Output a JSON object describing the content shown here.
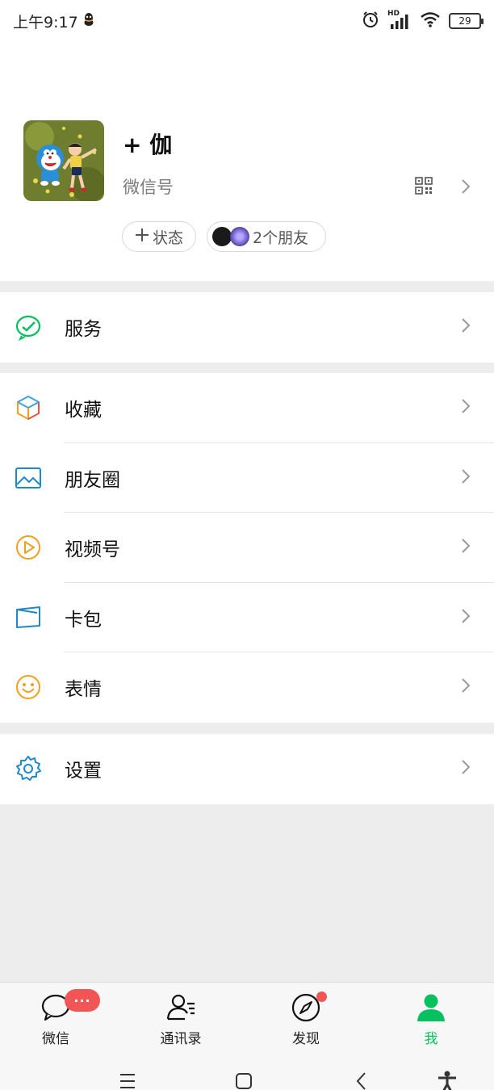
{
  "status_bar": {
    "time": "上午9:17",
    "network_label": "HD",
    "battery": "29"
  },
  "profile": {
    "nickname": "+ 伽",
    "wechat_id_label": "微信号",
    "status_button_label": "状态",
    "friends_label": "2个朋友"
  },
  "menu": {
    "service": {
      "label": "服务",
      "icon": "wechat-pay-icon",
      "color": "#07c160"
    },
    "items": [
      {
        "label": "收藏",
        "icon": "favorites-cube-icon"
      },
      {
        "label": "朋友圈",
        "icon": "moments-picture-icon",
        "color": "#1e88c8"
      },
      {
        "label": "视频号",
        "icon": "channels-play-icon",
        "color": "#f0a020"
      },
      {
        "label": "卡包",
        "icon": "card-wallet-icon",
        "color": "#1e88c8"
      },
      {
        "label": "表情",
        "icon": "sticker-smile-icon",
        "color": "#f0a020"
      }
    ],
    "settings": {
      "label": "设置",
      "icon": "gear-icon",
      "color": "#1e88c8"
    }
  },
  "tabbar": {
    "tabs": [
      {
        "label": "微信",
        "icon": "chat-bubble-icon",
        "badge": "···"
      },
      {
        "label": "通讯录",
        "icon": "contacts-icon"
      },
      {
        "label": "发现",
        "icon": "compass-icon",
        "dot": true
      },
      {
        "label": "我",
        "icon": "person-icon",
        "active": true
      }
    ],
    "active_color": "#07c160",
    "badge_color": "#f25555"
  }
}
